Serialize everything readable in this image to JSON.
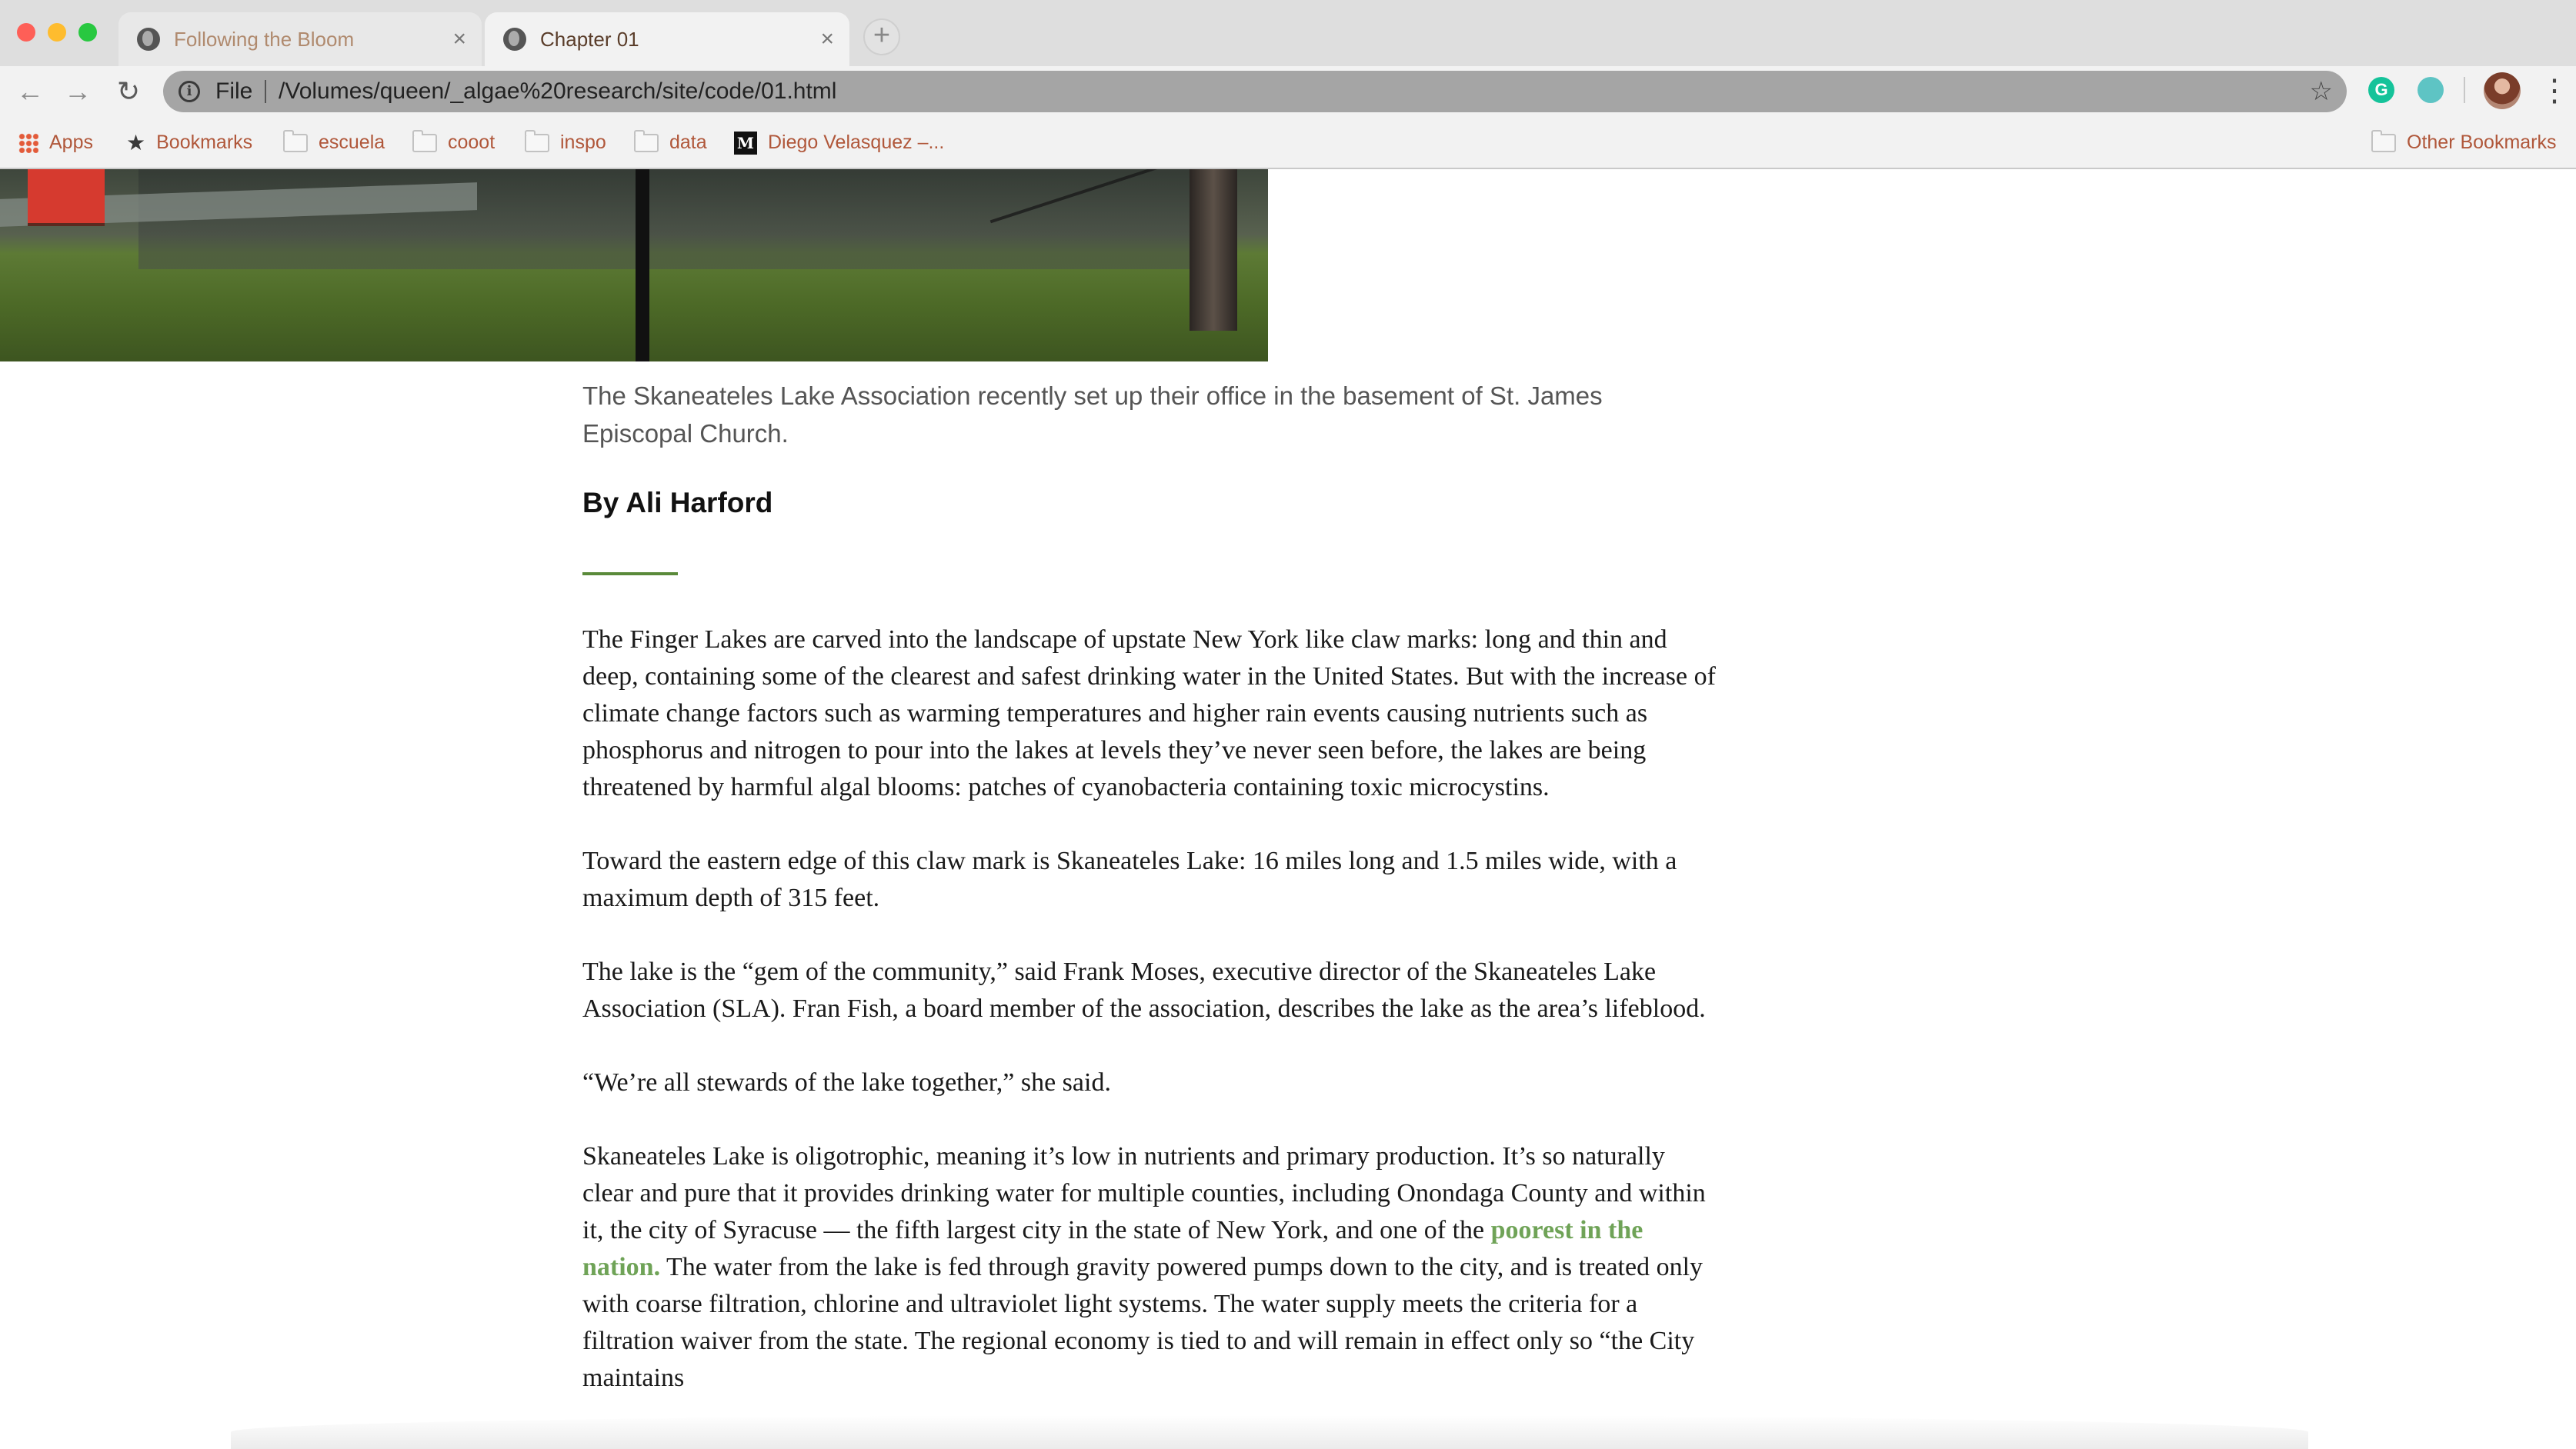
{
  "browser": {
    "tabs": [
      {
        "title": "Following the Bloom",
        "close": "×"
      },
      {
        "title": "Chapter 01",
        "close": "×"
      }
    ],
    "new_tab": "+",
    "nav": {
      "back": "←",
      "forward": "→",
      "reload": "↻"
    },
    "address": {
      "info": "i",
      "scheme": "File",
      "url": "/Volumes/queen/_algae%20research/site/code/01.html",
      "star": "☆"
    },
    "extensions": {
      "grammarly": "G"
    },
    "menu": "⋮",
    "bookmarks": [
      {
        "label": "Apps",
        "icon": "apps-grid-icon"
      },
      {
        "label": "Bookmarks",
        "icon": "star-icon"
      },
      {
        "label": "escuela",
        "icon": "folder-icon"
      },
      {
        "label": "cooot",
        "icon": "folder-icon"
      },
      {
        "label": "inspo",
        "icon": "folder-icon"
      },
      {
        "label": "data",
        "icon": "folder-icon"
      },
      {
        "label": "Diego Velasquez –...",
        "icon": "medium-logo-icon"
      }
    ],
    "other_bookmarks": "Other Bookmarks",
    "medium_letter": "M"
  },
  "article": {
    "caption": "The Skaneateles Lake Association recently set up their office in the basement of St. James Episcopal Church.",
    "byline": "By Ali Harford",
    "p1": "The Finger Lakes are carved into the landscape of upstate New York like claw marks: long and thin and deep, containing some of the clearest and safest drinking water in the United States. But with the increase of climate change factors such as warming temperatures and higher rain events causing nutrients such as phosphorus and nitrogen to pour into the lakes at levels they’ve never seen before, the lakes are being threatened by harmful algal blooms: patches of cyanobacteria containing toxic microcystins.",
    "p2": "Toward the eastern edge of this claw mark is Skaneateles Lake: 16 miles long and 1.5 miles wide, with a maximum depth of 315 feet.",
    "p3": "The lake is the “gem of the community,” said Frank Moses, executive director of the Skaneateles Lake Association (SLA). Fran Fish, a board member of the association, describes the lake as the area’s lifeblood.",
    "p4": "“We’re all stewards of the lake together,” she said.",
    "p5_before": "Skaneateles Lake is oligotrophic, meaning it’s low in nutrients and primary production. It’s so naturally clear and pure that it provides drinking water for multiple counties, including Onondaga County and within it, the city of Syracuse — the fifth largest city in the state of New York, and one of the ",
    "p5_link": "poorest in the nation.",
    "p5_after": " The water from the lake is fed through gravity powered pumps down to the city, and is treated only with coarse filtration, chlorine and ultraviolet light systems. The water supply meets the criteria for a filtration waiver from the state. The regional economy is tied to and will remain in effect only so “the City maintains"
  }
}
